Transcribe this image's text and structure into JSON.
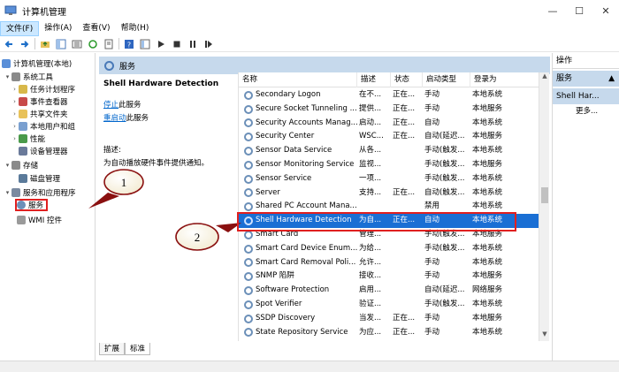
{
  "window": {
    "title": "计算机管理"
  },
  "menu": [
    "文件(F)",
    "操作(A)",
    "查看(V)",
    "帮助(H)"
  ],
  "tree": [
    {
      "label": "计算机管理(本地)",
      "level": 0,
      "exp": ""
    },
    {
      "label": "系统工具",
      "level": 1,
      "exp": "▾"
    },
    {
      "label": "任务计划程序",
      "level": 2,
      "exp": "›"
    },
    {
      "label": "事件查看器",
      "level": 2,
      "exp": "›"
    },
    {
      "label": "共享文件夹",
      "level": 2,
      "exp": "›"
    },
    {
      "label": "本地用户和组",
      "level": 2,
      "exp": "›"
    },
    {
      "label": "性能",
      "level": 2,
      "exp": "›"
    },
    {
      "label": "设备管理器",
      "level": 2,
      "exp": ""
    },
    {
      "label": "存储",
      "level": 1,
      "exp": "▾"
    },
    {
      "label": "磁盘管理",
      "level": 2,
      "exp": ""
    },
    {
      "label": "服务和应用程序",
      "level": 1,
      "exp": "▾"
    },
    {
      "label": "服务",
      "level": 2,
      "exp": ""
    },
    {
      "label": "WMI 控件",
      "level": 2,
      "exp": ""
    }
  ],
  "center": {
    "header": "服务",
    "selected_name": "Shell Hardware Detection",
    "stop_link": "停止",
    "stop_suffix": "此服务",
    "restart_link": "重启动",
    "restart_suffix": "此服务",
    "desc_label": "描述:",
    "desc_text": "为自动播放硬件事件提供通知。",
    "columns": [
      "名称",
      "描述",
      "状态",
      "启动类型",
      "登录为"
    ],
    "rows": [
      {
        "name": "Secondary Logon",
        "desc": "在不...",
        "status": "正在...",
        "startup": "手动",
        "logon": "本地系统"
      },
      {
        "name": "Secure Socket Tunneling ...",
        "desc": "提供...",
        "status": "正在...",
        "startup": "手动",
        "logon": "本地服务"
      },
      {
        "name": "Security Accounts Manag...",
        "desc": "启动...",
        "status": "正在...",
        "startup": "自动",
        "logon": "本地系统"
      },
      {
        "name": "Security Center",
        "desc": "WSC...",
        "status": "正在...",
        "startup": "自动(延迟...",
        "logon": "本地服务"
      },
      {
        "name": "Sensor Data Service",
        "desc": "从各...",
        "status": "",
        "startup": "手动(触发...",
        "logon": "本地系统"
      },
      {
        "name": "Sensor Monitoring Service",
        "desc": "监视...",
        "status": "",
        "startup": "手动(触发...",
        "logon": "本地服务"
      },
      {
        "name": "Sensor Service",
        "desc": "一项...",
        "status": "",
        "startup": "手动(触发...",
        "logon": "本地系统"
      },
      {
        "name": "Server",
        "desc": "支持...",
        "status": "正在...",
        "startup": "自动(触发...",
        "logon": "本地系统"
      },
      {
        "name": "Shared PC Account Mana...",
        "desc": "",
        "status": "",
        "startup": "禁用",
        "logon": "本地系统"
      },
      {
        "name": "Shell Hardware Detection",
        "desc": "为自...",
        "status": "正在...",
        "startup": "自动",
        "logon": "本地系统"
      },
      {
        "name": "Smart Card",
        "desc": "管理...",
        "status": "",
        "startup": "手动(触发...",
        "logon": "本地服务"
      },
      {
        "name": "Smart Card Device Enum...",
        "desc": "为给...",
        "status": "",
        "startup": "手动(触发...",
        "logon": "本地系统"
      },
      {
        "name": "Smart Card Removal Poli...",
        "desc": "允许...",
        "status": "",
        "startup": "手动",
        "logon": "本地系统"
      },
      {
        "name": "SNMP 陷阱",
        "desc": "接收...",
        "status": "",
        "startup": "手动",
        "logon": "本地服务"
      },
      {
        "name": "Software Protection",
        "desc": "启用...",
        "status": "",
        "startup": "自动(延迟...",
        "logon": "网络服务"
      },
      {
        "name": "Spot Verifier",
        "desc": "验证...",
        "status": "",
        "startup": "手动(触发...",
        "logon": "本地系统"
      },
      {
        "name": "SSDP Discovery",
        "desc": "当发...",
        "status": "正在...",
        "startup": "手动",
        "logon": "本地服务"
      },
      {
        "name": "State Repository Service",
        "desc": "为应...",
        "status": "正在...",
        "startup": "手动",
        "logon": "本地系统"
      }
    ],
    "tabs": [
      "扩展",
      "标准"
    ]
  },
  "actions": {
    "title": "操作",
    "section1": "服务",
    "section2": "Shell Har...",
    "more": "更多..."
  },
  "callouts": [
    "1",
    "2"
  ],
  "colors": {
    "selection": "#1a6fd4",
    "header_bg": "#c6d9ec",
    "callout": "#e02020"
  }
}
